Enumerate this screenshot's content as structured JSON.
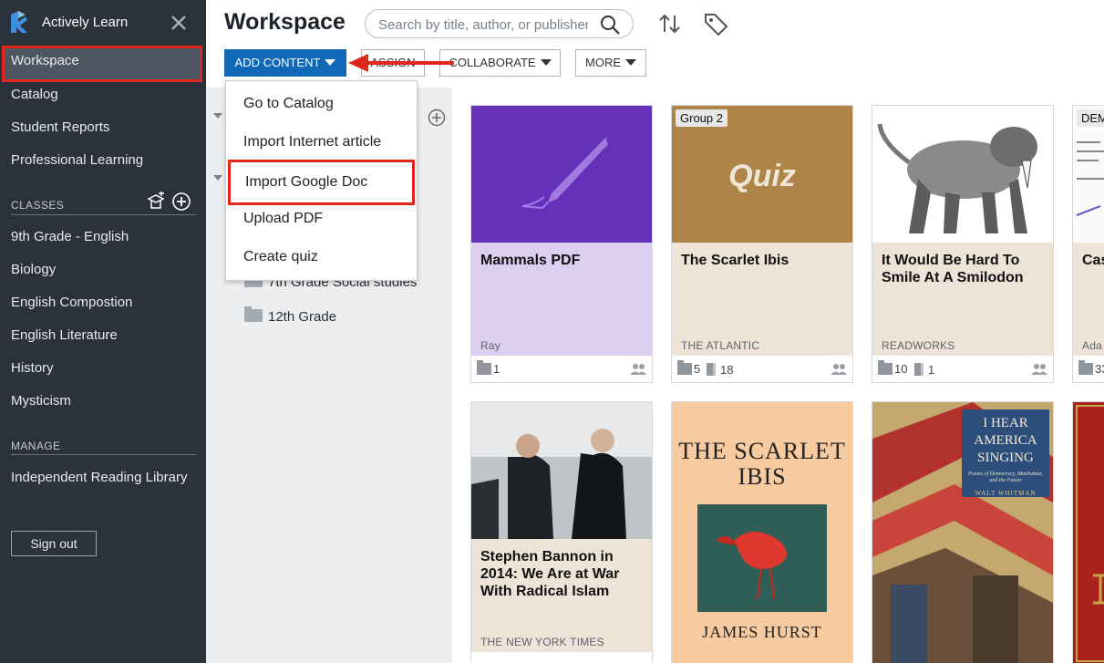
{
  "app": {
    "name": "Actively Learn"
  },
  "sidebar": {
    "nav": [
      {
        "label": "Workspace",
        "active": true
      },
      {
        "label": "Catalog"
      },
      {
        "label": "Student Reports"
      },
      {
        "label": "Professional Learning"
      }
    ],
    "classes_label": "CLASSES",
    "classes": [
      "9th Grade - English",
      "Biology",
      "English Compostion",
      "English Literature",
      "History",
      "Mysticism"
    ],
    "manage_label": "MANAGE",
    "manage": [
      "Independent Reading Library"
    ],
    "sign_out": "Sign out"
  },
  "header": {
    "title": "Workspace",
    "search_placeholder": "Search by title, author, or publisher"
  },
  "toolbar": {
    "add_content": "ADD CONTENT",
    "assign": "ASSIGN",
    "collaborate": "COLLABORATE",
    "more": "MORE"
  },
  "dropdown": {
    "items": [
      "Go to Catalog",
      "Import Internet article",
      "Import Google Doc",
      "Upload PDF",
      "Create quiz"
    ],
    "highlighted_index": 2
  },
  "folders": [
    "7th Grade Social studies",
    "12th Grade"
  ],
  "cards": [
    {
      "title": "Mammals PDF",
      "source": "Ray",
      "folders": "1",
      "books": "",
      "bg": "#dccff0"
    },
    {
      "title": "The Scarlet Ibis",
      "source": "THE ATLANTIC",
      "folders": "5",
      "books": "18",
      "badge": "Group 2",
      "cover_text": "Quiz",
      "bg": "#ede3d6"
    },
    {
      "title": "It Would Be Hard To Smile At A Smilodon",
      "source": "READWORKS",
      "folders": "10",
      "books": "1",
      "bg": "#ede3d6"
    },
    {
      "title": "Cas",
      "source": "Ada",
      "folders": "33",
      "books": "",
      "badge": "DEM",
      "bg": "#ede3d6"
    },
    {
      "title": "Stephen Bannon in 2014: We Are at War With Radical Islam",
      "source": "THE NEW YORK TIMES",
      "bg": "#ede3d6"
    },
    {
      "cover_title": "The Scarlet Ibis",
      "cover_author": "James Hurst"
    },
    {
      "cover_title": "I Hear America Singing",
      "cover_subtitle": "Poems of Democracy, Manhattan, and the Future",
      "cover_author": "WALT WHITMAN"
    },
    {}
  ],
  "colors": {
    "sidebar": "#2b323b",
    "primary": "#1268b8",
    "highlight": "#e1261c"
  }
}
